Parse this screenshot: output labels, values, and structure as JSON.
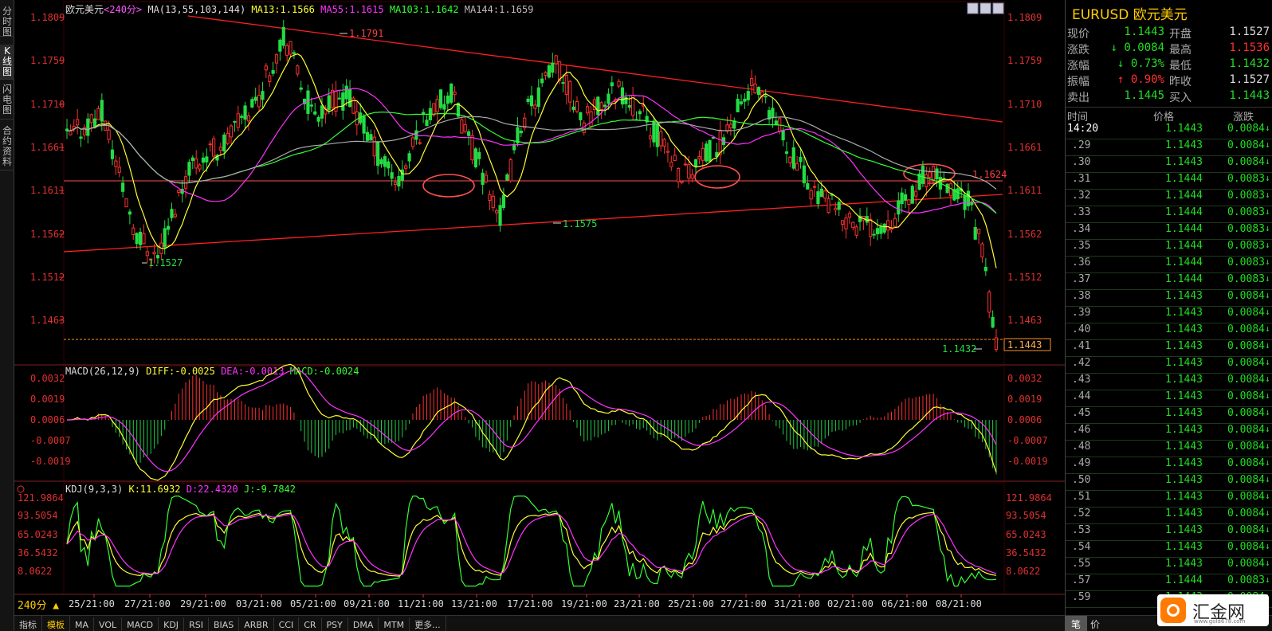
{
  "sidebar": {
    "tabs": [
      "分时图",
      "K线图",
      "闪电图",
      "合约资料"
    ]
  },
  "chart": {
    "title": "欧元美元",
    "period": "<240分>",
    "ma_label": "MA(13,55,103,144)",
    "ma13": "MA13:1.1566",
    "ma55": "MA55:1.1615",
    "ma103": "MA103:1.1642",
    "ma144": "MA144:1.1659",
    "price_ticks": [
      "1.1809",
      "1.1759",
      "1.1710",
      "1.1661",
      "1.1611",
      "1.1562",
      "1.1512",
      "1.1463"
    ],
    "high_label": "1.1791",
    "low_label1": "1.1527",
    "low_label2": "1.1575",
    "last_low": "1.1432",
    "level_label": "1.1624",
    "cur_box": "1.1443",
    "dates": [
      "25/21:00",
      "27/21:00",
      "29/21:00",
      "03/21:00",
      "05/21:00",
      "09/21:00",
      "11/21:00",
      "13/21:00",
      "17/21:00",
      "19/21:00",
      "23/21:00",
      "25/21:00",
      "27/21:00",
      "31/21:00",
      "02/21:00",
      "06/21:00",
      "08/21:00"
    ],
    "macd_label": "MACD(26,12,9)",
    "diff": "DIFF:-0.0025",
    "dea": "DEA:-0.0013",
    "macd": "MACD:-0.0024",
    "macd_ticks": [
      "0.0032",
      "0.0019",
      "0.0006",
      "-0.0007",
      "-0.0019"
    ],
    "kdj_label": "KDJ(9,3,3)",
    "k": "K:11.6932",
    "d": "D:22.4320",
    "j": "J:-9.7842",
    "kdj_ticks": [
      "121.9864",
      "93.5054",
      "65.0243",
      "36.5432",
      "8.0622"
    ],
    "period_btn": "240分 ▲",
    "bottom_tabs": [
      "指标",
      "模板",
      "MA",
      "VOL",
      "MACD",
      "KDJ",
      "RSI",
      "BIAS",
      "ARBR",
      "CCI",
      "CR",
      "PSY",
      "DMA",
      "MTM",
      "更多..."
    ]
  },
  "quote": {
    "title": "EURUSD 欧元美元",
    "rows": [
      {
        "l1": "现价",
        "v1": "1.1443",
        "c1": "g",
        "l2": "开盘",
        "v2": "1.1527",
        "c2": "w"
      },
      {
        "l1": "涨跌",
        "v1": "↓ 0.0084",
        "c1": "g",
        "l2": "最高",
        "v2": "1.1536",
        "c2": "r"
      },
      {
        "l1": "涨幅",
        "v1": "↓ 0.73%",
        "c1": "g",
        "l2": "最低",
        "v2": "1.1432",
        "c2": "g"
      },
      {
        "l1": "振幅",
        "v1": "↑ 0.90%",
        "c1": "r",
        "l2": "昨收",
        "v2": "1.1527",
        "c2": "w"
      },
      {
        "l1": "卖出",
        "v1": "1.1445",
        "c1": "g",
        "l2": "买入",
        "v2": "1.1443",
        "c2": "g"
      }
    ],
    "head": {
      "time": "时间",
      "price": "价格",
      "change": "涨跌"
    },
    "ticks": [
      {
        "t": "14:20",
        "p": "1.1443",
        "c": "0.0084"
      },
      {
        "t": ".29",
        "p": "1.1443",
        "c": "0.0084"
      },
      {
        "t": ".30",
        "p": "1.1443",
        "c": "0.0084"
      },
      {
        "t": ".31",
        "p": "1.1444",
        "c": "0.0083"
      },
      {
        "t": ".32",
        "p": "1.1444",
        "c": "0.0083"
      },
      {
        "t": ".33",
        "p": "1.1444",
        "c": "0.0083"
      },
      {
        "t": ".34",
        "p": "1.1444",
        "c": "0.0083"
      },
      {
        "t": ".35",
        "p": "1.1444",
        "c": "0.0083"
      },
      {
        "t": ".36",
        "p": "1.1444",
        "c": "0.0083"
      },
      {
        "t": ".37",
        "p": "1.1444",
        "c": "0.0083"
      },
      {
        "t": ".38",
        "p": "1.1443",
        "c": "0.0084"
      },
      {
        "t": ".39",
        "p": "1.1443",
        "c": "0.0084"
      },
      {
        "t": ".40",
        "p": "1.1443",
        "c": "0.0084"
      },
      {
        "t": ".41",
        "p": "1.1443",
        "c": "0.0084"
      },
      {
        "t": ".42",
        "p": "1.1443",
        "c": "0.0084"
      },
      {
        "t": ".43",
        "p": "1.1443",
        "c": "0.0084"
      },
      {
        "t": ".44",
        "p": "1.1443",
        "c": "0.0084"
      },
      {
        "t": ".45",
        "p": "1.1443",
        "c": "0.0084"
      },
      {
        "t": ".46",
        "p": "1.1443",
        "c": "0.0084"
      },
      {
        "t": ".48",
        "p": "1.1443",
        "c": "0.0084"
      },
      {
        "t": ".49",
        "p": "1.1443",
        "c": "0.0084"
      },
      {
        "t": ".50",
        "p": "1.1443",
        "c": "0.0084"
      },
      {
        "t": ".51",
        "p": "1.1443",
        "c": "0.0084"
      },
      {
        "t": ".52",
        "p": "1.1443",
        "c": "0.0084"
      },
      {
        "t": ".53",
        "p": "1.1443",
        "c": "0.0084"
      },
      {
        "t": ".54",
        "p": "1.1443",
        "c": "0.0084"
      },
      {
        "t": ".55",
        "p": "1.1443",
        "c": "0.0084"
      },
      {
        "t": ".57",
        "p": "1.1444",
        "c": "0.0083"
      },
      {
        "t": ".59",
        "p": "1.1443",
        "c": "0.0084"
      }
    ],
    "bottom": [
      "笔",
      "价"
    ],
    "logo_text": "汇金网",
    "logo_sub": "www.gold678.com"
  }
}
